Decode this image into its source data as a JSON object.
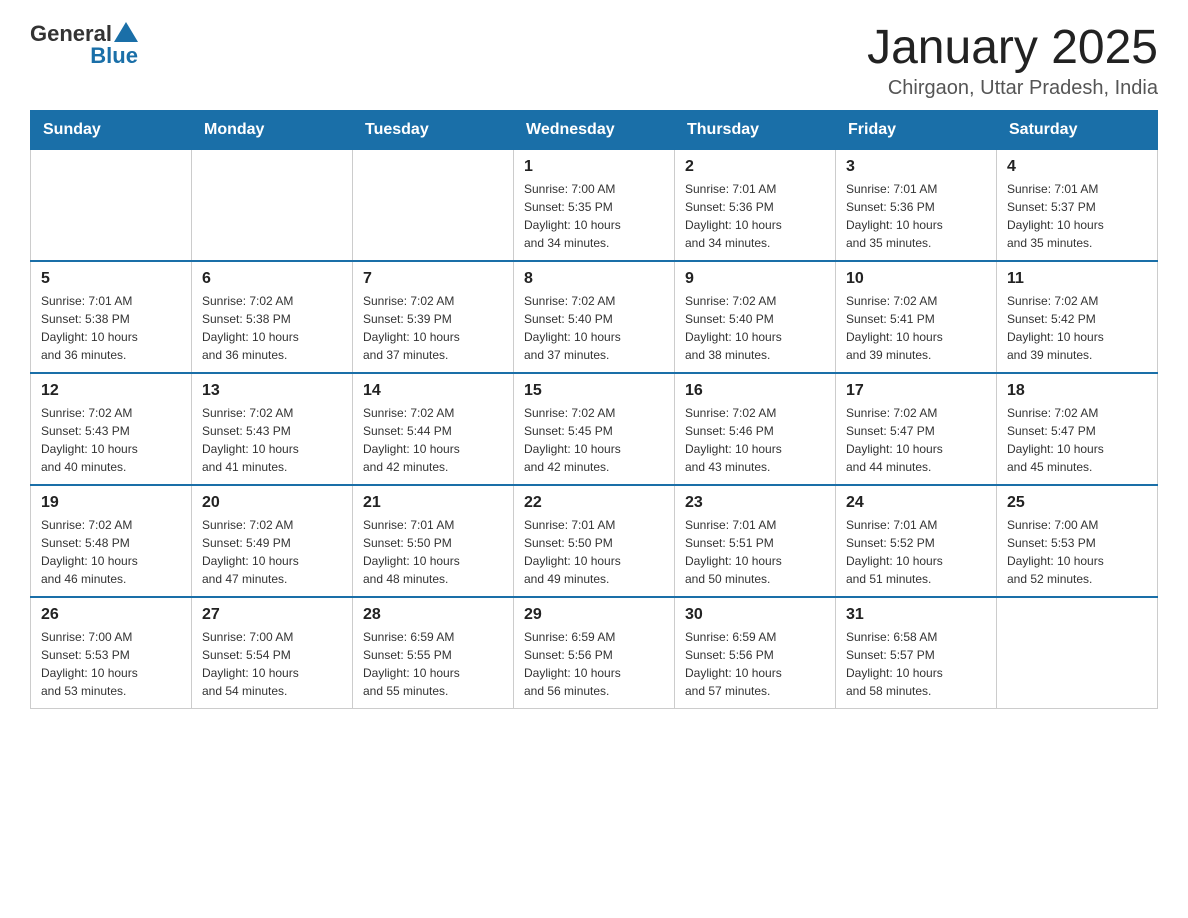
{
  "header": {
    "logo": {
      "general": "General",
      "blue": "Blue"
    },
    "title": "January 2025",
    "subtitle": "Chirgaon, Uttar Pradesh, India"
  },
  "days_of_week": [
    "Sunday",
    "Monday",
    "Tuesday",
    "Wednesday",
    "Thursday",
    "Friday",
    "Saturday"
  ],
  "weeks": [
    {
      "days": [
        {
          "num": "",
          "info": ""
        },
        {
          "num": "",
          "info": ""
        },
        {
          "num": "",
          "info": ""
        },
        {
          "num": "1",
          "info": "Sunrise: 7:00 AM\nSunset: 5:35 PM\nDaylight: 10 hours\nand 34 minutes."
        },
        {
          "num": "2",
          "info": "Sunrise: 7:01 AM\nSunset: 5:36 PM\nDaylight: 10 hours\nand 34 minutes."
        },
        {
          "num": "3",
          "info": "Sunrise: 7:01 AM\nSunset: 5:36 PM\nDaylight: 10 hours\nand 35 minutes."
        },
        {
          "num": "4",
          "info": "Sunrise: 7:01 AM\nSunset: 5:37 PM\nDaylight: 10 hours\nand 35 minutes."
        }
      ]
    },
    {
      "days": [
        {
          "num": "5",
          "info": "Sunrise: 7:01 AM\nSunset: 5:38 PM\nDaylight: 10 hours\nand 36 minutes."
        },
        {
          "num": "6",
          "info": "Sunrise: 7:02 AM\nSunset: 5:38 PM\nDaylight: 10 hours\nand 36 minutes."
        },
        {
          "num": "7",
          "info": "Sunrise: 7:02 AM\nSunset: 5:39 PM\nDaylight: 10 hours\nand 37 minutes."
        },
        {
          "num": "8",
          "info": "Sunrise: 7:02 AM\nSunset: 5:40 PM\nDaylight: 10 hours\nand 37 minutes."
        },
        {
          "num": "9",
          "info": "Sunrise: 7:02 AM\nSunset: 5:40 PM\nDaylight: 10 hours\nand 38 minutes."
        },
        {
          "num": "10",
          "info": "Sunrise: 7:02 AM\nSunset: 5:41 PM\nDaylight: 10 hours\nand 39 minutes."
        },
        {
          "num": "11",
          "info": "Sunrise: 7:02 AM\nSunset: 5:42 PM\nDaylight: 10 hours\nand 39 minutes."
        }
      ]
    },
    {
      "days": [
        {
          "num": "12",
          "info": "Sunrise: 7:02 AM\nSunset: 5:43 PM\nDaylight: 10 hours\nand 40 minutes."
        },
        {
          "num": "13",
          "info": "Sunrise: 7:02 AM\nSunset: 5:43 PM\nDaylight: 10 hours\nand 41 minutes."
        },
        {
          "num": "14",
          "info": "Sunrise: 7:02 AM\nSunset: 5:44 PM\nDaylight: 10 hours\nand 42 minutes."
        },
        {
          "num": "15",
          "info": "Sunrise: 7:02 AM\nSunset: 5:45 PM\nDaylight: 10 hours\nand 42 minutes."
        },
        {
          "num": "16",
          "info": "Sunrise: 7:02 AM\nSunset: 5:46 PM\nDaylight: 10 hours\nand 43 minutes."
        },
        {
          "num": "17",
          "info": "Sunrise: 7:02 AM\nSunset: 5:47 PM\nDaylight: 10 hours\nand 44 minutes."
        },
        {
          "num": "18",
          "info": "Sunrise: 7:02 AM\nSunset: 5:47 PM\nDaylight: 10 hours\nand 45 minutes."
        }
      ]
    },
    {
      "days": [
        {
          "num": "19",
          "info": "Sunrise: 7:02 AM\nSunset: 5:48 PM\nDaylight: 10 hours\nand 46 minutes."
        },
        {
          "num": "20",
          "info": "Sunrise: 7:02 AM\nSunset: 5:49 PM\nDaylight: 10 hours\nand 47 minutes."
        },
        {
          "num": "21",
          "info": "Sunrise: 7:01 AM\nSunset: 5:50 PM\nDaylight: 10 hours\nand 48 minutes."
        },
        {
          "num": "22",
          "info": "Sunrise: 7:01 AM\nSunset: 5:50 PM\nDaylight: 10 hours\nand 49 minutes."
        },
        {
          "num": "23",
          "info": "Sunrise: 7:01 AM\nSunset: 5:51 PM\nDaylight: 10 hours\nand 50 minutes."
        },
        {
          "num": "24",
          "info": "Sunrise: 7:01 AM\nSunset: 5:52 PM\nDaylight: 10 hours\nand 51 minutes."
        },
        {
          "num": "25",
          "info": "Sunrise: 7:00 AM\nSunset: 5:53 PM\nDaylight: 10 hours\nand 52 minutes."
        }
      ]
    },
    {
      "days": [
        {
          "num": "26",
          "info": "Sunrise: 7:00 AM\nSunset: 5:53 PM\nDaylight: 10 hours\nand 53 minutes."
        },
        {
          "num": "27",
          "info": "Sunrise: 7:00 AM\nSunset: 5:54 PM\nDaylight: 10 hours\nand 54 minutes."
        },
        {
          "num": "28",
          "info": "Sunrise: 6:59 AM\nSunset: 5:55 PM\nDaylight: 10 hours\nand 55 minutes."
        },
        {
          "num": "29",
          "info": "Sunrise: 6:59 AM\nSunset: 5:56 PM\nDaylight: 10 hours\nand 56 minutes."
        },
        {
          "num": "30",
          "info": "Sunrise: 6:59 AM\nSunset: 5:56 PM\nDaylight: 10 hours\nand 57 minutes."
        },
        {
          "num": "31",
          "info": "Sunrise: 6:58 AM\nSunset: 5:57 PM\nDaylight: 10 hours\nand 58 minutes."
        },
        {
          "num": "",
          "info": ""
        }
      ]
    }
  ]
}
